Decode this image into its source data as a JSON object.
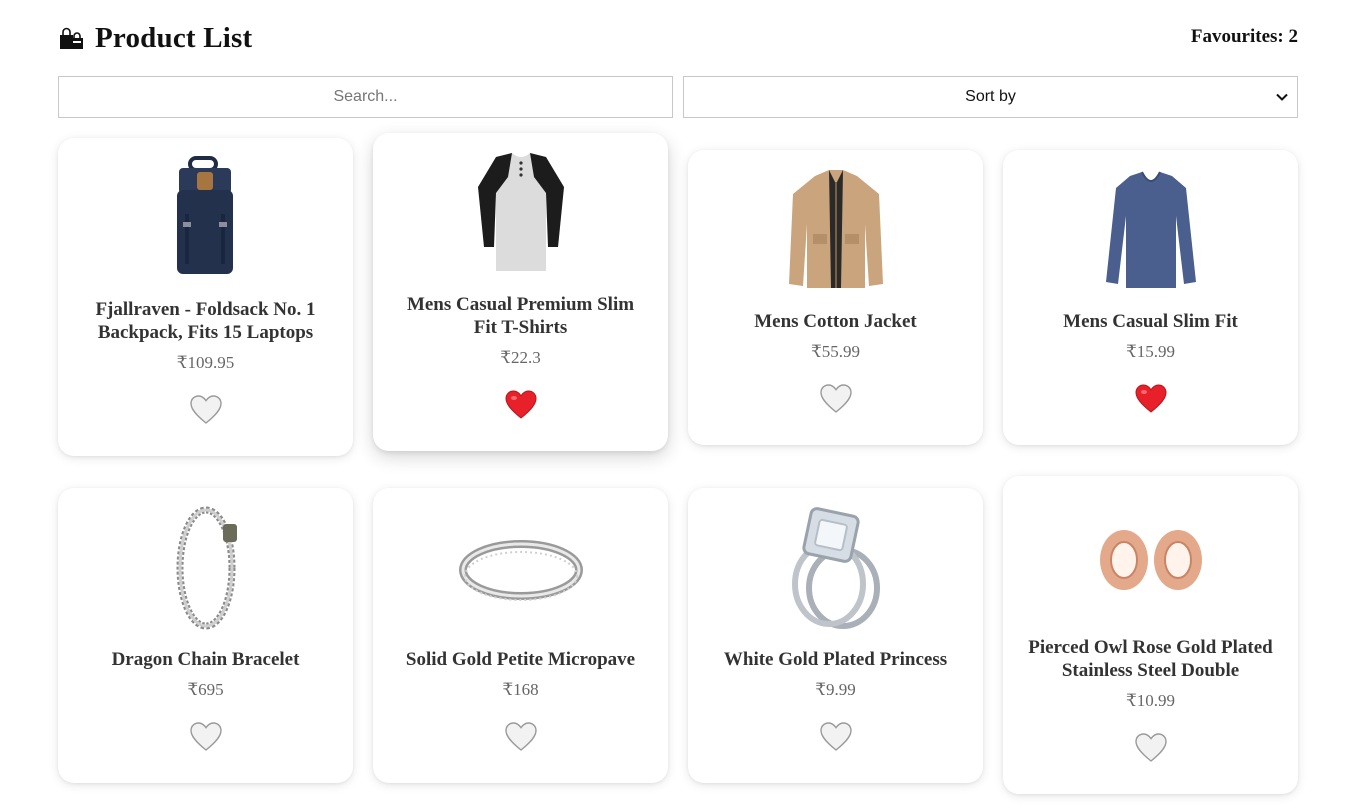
{
  "header": {
    "title": "Product List",
    "favourites_label": "Favourites: 2"
  },
  "controls": {
    "search_placeholder": "Search...",
    "sort_selected": "Sort by"
  },
  "colors": {
    "heart_active": "#e8202a",
    "heart_inactive": "#f2f2f2",
    "price_text": "#666666"
  },
  "products": [
    {
      "name": "Fjallraven - Foldsack No. 1 Backpack, Fits 15 Laptops",
      "price": "₹109.95",
      "favourite": false,
      "icon": "backpack-icon"
    },
    {
      "name": "Mens Casual Premium Slim Fit T-Shirts",
      "price": "₹22.3",
      "favourite": true,
      "icon": "tshirt-icon"
    },
    {
      "name": "Mens Cotton Jacket",
      "price": "₹55.99",
      "favourite": false,
      "icon": "jacket-icon"
    },
    {
      "name": "Mens Casual Slim Fit",
      "price": "₹15.99",
      "favourite": true,
      "icon": "longsleeve-icon"
    },
    {
      "name": "Dragon Chain Bracelet",
      "price": "₹695",
      "favourite": false,
      "icon": "bracelet-icon"
    },
    {
      "name": "Solid Gold Petite Micropave",
      "price": "₹168",
      "favourite": false,
      "icon": "ring-band-icon"
    },
    {
      "name": "White Gold Plated Princess",
      "price": "₹9.99",
      "favourite": false,
      "icon": "diamond-ring-icon"
    },
    {
      "name": "Pierced Owl Rose Gold Plated Stainless Steel Double",
      "price": "₹10.99",
      "favourite": false,
      "icon": "ear-tunnel-icon"
    }
  ]
}
